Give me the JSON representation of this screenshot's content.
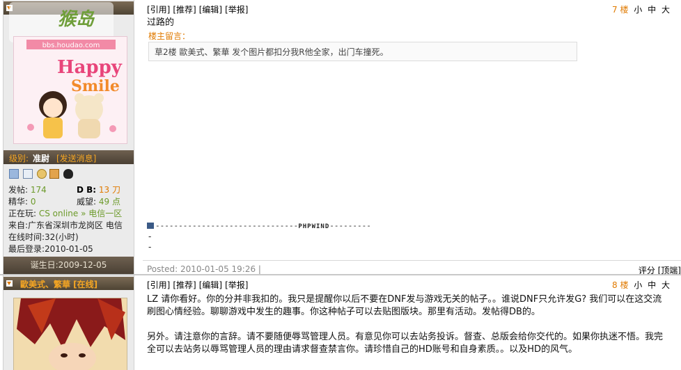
{
  "posts": [
    {
      "username": "",
      "nickname": "",
      "avatar_watermark": "bbs.houdao.com",
      "grade_label": "级别:",
      "grade_value": "准尉",
      "send_message": "[发送消息]",
      "icons": [
        "profile-card-icon",
        "document-icon",
        "add-friend-icon",
        "mail-icon",
        "qq-icon"
      ],
      "stats": {
        "posts_label": "发帖:",
        "posts_value": "174",
        "db_label": "D B:",
        "db_value": "13 刀",
        "essence_label": "精华:",
        "essence_value": "0",
        "prestige_label": "威望:",
        "prestige_value": "49 点",
        "playing_label": "正在玩:",
        "playing_game": "CS online",
        "playing_sep": "»",
        "playing_server": "电信一区",
        "from": "来自:广东省深圳市龙岗区 电信",
        "online_time": "在线时间:32(小时)",
        "last_login": "最后登录:2010-01-05"
      },
      "birthday": "诞生日:2009-12-05",
      "toolbar": [
        "[引用]",
        "[推荐]",
        "[编辑]",
        "[举报]"
      ],
      "floor": "7 楼",
      "size_small": "小",
      "size_medium": "中",
      "size_large": "大",
      "text": "过路的",
      "owner_label": "楼主留言：",
      "owner_message": "草2楼  歐美式、繁華  发个图片都扣分我R他全家，出门车撞死。",
      "signature_dashes": "-------------------------------",
      "signature_brand": "PHPWIND",
      "signature_tail": "---------",
      "sig_line1": "-",
      "sig_line2": "-",
      "posted": "Posted: 2010-01-05 19:26 |",
      "actions": "评分 [顶端]"
    },
    {
      "username": "歐美式、繁華 [在线]",
      "toolbar": [
        "[引用]",
        "[推荐]",
        "[编辑]",
        "[举报]"
      ],
      "floor": "8 楼",
      "size_small": "小",
      "size_medium": "中",
      "size_large": "大",
      "paragraph1": "LZ 请你看好。你的分并非我扣的。我只是提醒你以后不要在DNF发与游戏无关的帖子。。谁说DNF只允许发G?  我们可以在这交流刷图心情经验。聊聊游戏中发生的趣事。你这种帖子可以去贴图版块。那里有活动。发帖得DB的。",
      "paragraph2": "另外。请注意你的言辞。请不要随便辱骂管理人员。有意见你可以去站务投诉。督查、总版会给你交代的。如果你执迷不悟。我完全可以去站务以辱骂管理人员的理由请求督查禁言你。请珍惜自己的HD账号和自身素质。。以及HD的风气。"
    }
  ],
  "colors": {
    "accent_orange": "#e07a00",
    "stat_green": "#6c9a2a",
    "bar_brown": "#5a4e40"
  }
}
